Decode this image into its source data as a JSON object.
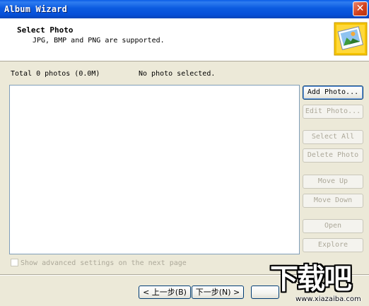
{
  "window": {
    "title": "Album Wizard",
    "close_glyph": "✕"
  },
  "header": {
    "title": "Select Photo",
    "subtitle": "JPG, BMP and PNG are supported.",
    "icon": "photo-album-icon"
  },
  "status": {
    "total": "Total 0 photos (0.0M)",
    "selection": "No photo selected."
  },
  "buttons": {
    "add_photo": "Add Photo...",
    "edit_photo": "Edit Photo...",
    "select_all": "Select All",
    "delete_photo": "Delete Photo",
    "move_up": "Move Up",
    "move_down": "Move Down",
    "open": "Open",
    "explore": "Explore"
  },
  "advanced_checkbox": {
    "label": "Show advanced settings on the next page",
    "checked": false
  },
  "nav": {
    "back": "< 上一步(B)",
    "next": "下一步(N) >"
  },
  "watermark": {
    "logo": "下载吧",
    "url": "www.xiazaiba.com"
  },
  "colors": {
    "titlebar": "#0a5ce6",
    "dialog_bg": "#ece9d8",
    "button_border": "#003c74",
    "disabled_text": "#aca899"
  }
}
